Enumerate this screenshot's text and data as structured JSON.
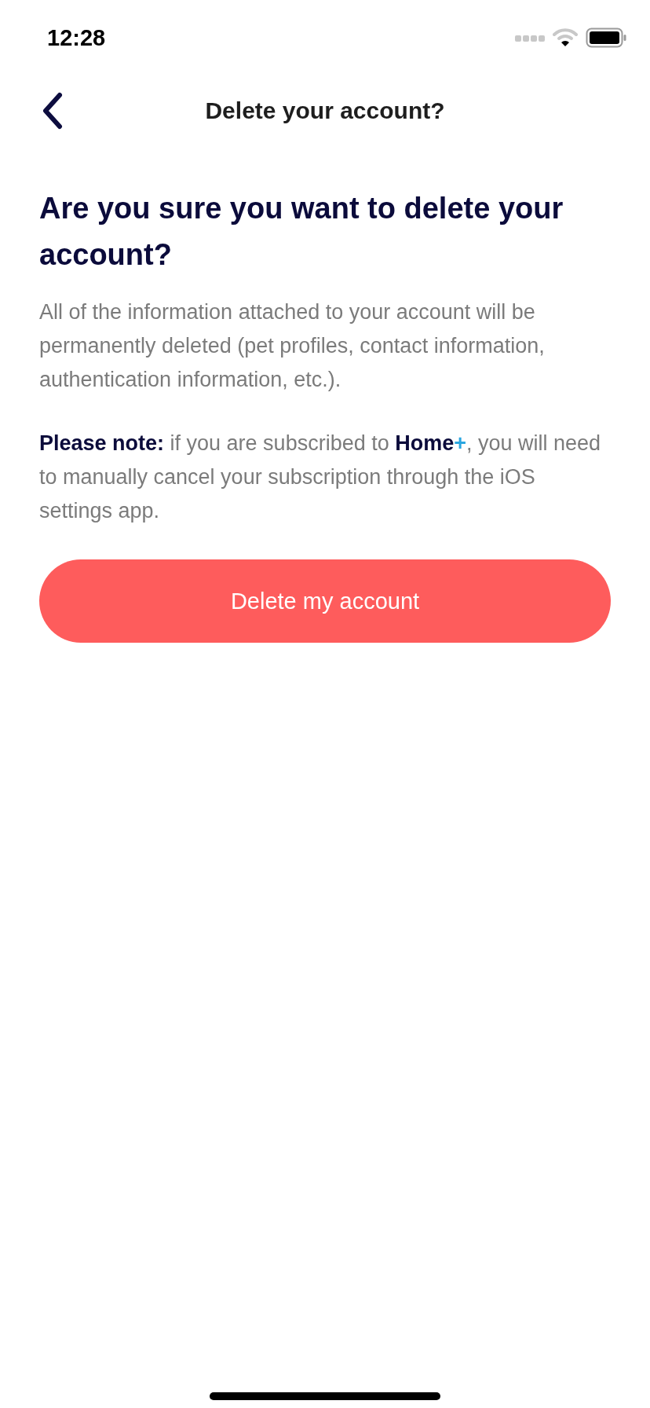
{
  "status_bar": {
    "time": "12:28"
  },
  "nav": {
    "title": "Delete your account?"
  },
  "heading": "Are you sure you want to delete your account?",
  "description": "All of the information attached to your account will be permanently deleted (pet profiles, contact information, authentication information, etc.).",
  "note": [
    {
      "kind": "strong",
      "text": "Please note:"
    },
    {
      "kind": "plain",
      "text": " if you are subscribed to "
    },
    {
      "kind": "strong",
      "text": "Home"
    },
    {
      "kind": "accent",
      "text": "+"
    },
    {
      "kind": "plain",
      "text": ", you will need to manually cancel your subscription through the iOS settings app."
    }
  ],
  "button": {
    "label": "Delete my account"
  }
}
